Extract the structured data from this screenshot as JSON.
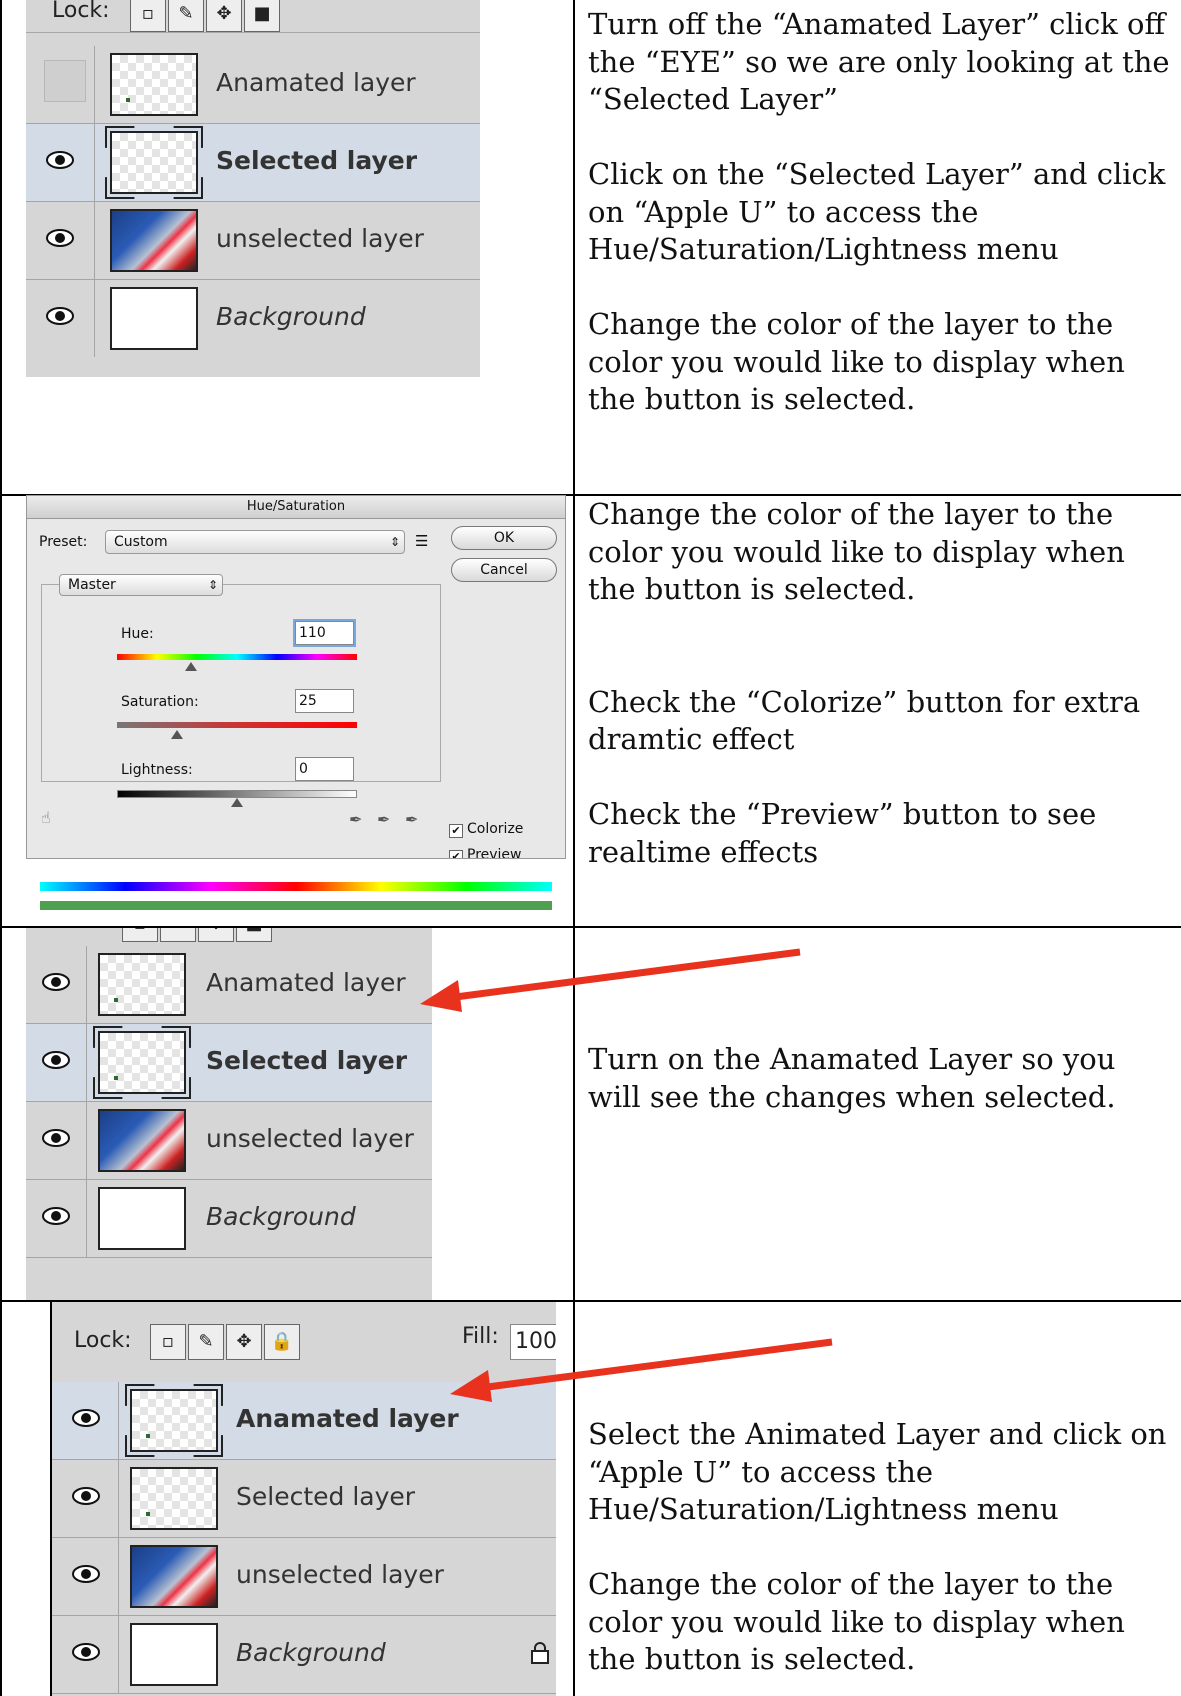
{
  "rows": [
    {
      "text": [
        "Turn off the “Anamated Layer” click off the “EYE” so we are only looking at the “Selected Layer”",
        "Click on the “Selected Layer” and click on “Apple U” to access the Hue/Saturation/Lightness menu",
        "Change the color of the layer to the color you would like to display when the button is selected."
      ]
    },
    {
      "text": [
        "Change the color of the layer to the color you would like to display when the button is selected.",
        "Check the “Colorize” button for extra dramtic effect",
        "Check the “Preview” button to see realtime effects"
      ]
    },
    {
      "text": [
        "Turn on the Anamated Layer so you will see the changes when selected."
      ]
    },
    {
      "text": [
        "Select the Animated Layer and click on “Apple U” to access the Hue/Saturation/Lightness menu",
        "Change the color of the layer to the color you would like to display when the button is selected."
      ]
    }
  ],
  "layers_panel": {
    "lock_label": "Lock:",
    "fill_label": "Fill:",
    "fill_value": "100",
    "layers": {
      "animated": "Anamated layer",
      "selected": "Selected layer",
      "unselected": "unselected layer",
      "background": "Background"
    }
  },
  "dialog": {
    "title": "Hue/Saturation",
    "preset_label": "Preset:",
    "preset_value": "Custom",
    "ok_label": "OK",
    "cancel_label": "Cancel",
    "channel_value": "Master",
    "hue_label": "Hue:",
    "hue_value": "110",
    "saturation_label": "Saturation:",
    "saturation_value": "25",
    "lightness_label": "Lightness:",
    "lightness_value": "0",
    "colorize_label": "Colorize",
    "colorize_checked": true,
    "preview_label": "Preview",
    "preview_checked": true
  },
  "colors": {
    "arrow": "#e8321e",
    "selected_row": "#d3dbe6"
  }
}
